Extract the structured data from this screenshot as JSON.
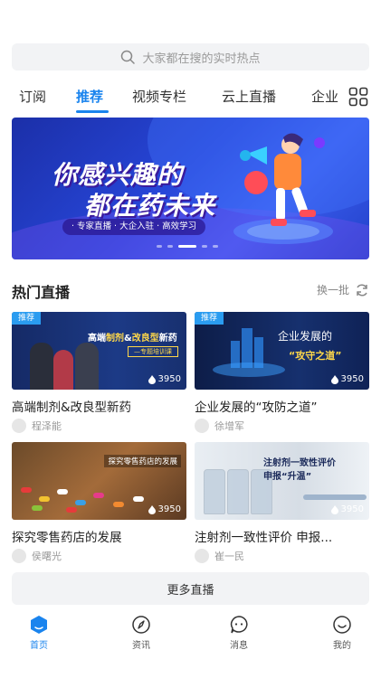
{
  "search": {
    "placeholder": "大家都在搜的实时热点"
  },
  "tabs": [
    {
      "label": "订阅",
      "active": false
    },
    {
      "label": "推荐",
      "active": true
    },
    {
      "label": "视频专栏",
      "active": false
    },
    {
      "label": "云上直播",
      "active": false
    },
    {
      "label": "企业",
      "active": false
    }
  ],
  "banner": {
    "line1": "你感兴趣的",
    "line2": "都在药未来",
    "tags": "· 专家直播 · 大企入驻 · 高效学习",
    "slides": 5,
    "active_slide": 3
  },
  "section": {
    "title": "热门直播",
    "refresh_label": "换一批"
  },
  "cards": [
    {
      "badge": "推荐",
      "thumb_title_a": "高端",
      "thumb_title_b": "制剂",
      "thumb_title_c": "&",
      "thumb_title_d": "改良型",
      "thumb_title_e": "新药",
      "thumb_sub": "—专题培训课",
      "views": "3950",
      "title": "高端制剂&改良型新药",
      "author": "程泽能"
    },
    {
      "badge": "推荐",
      "thumb_title_a": "企业发展的",
      "thumb_sub": "“攻守之道”",
      "views": "3950",
      "title": "企业发展的“攻防之道”",
      "author": "徐增军"
    },
    {
      "thumb_title_a": "探究零售药店的发展",
      "views": "3950",
      "title": "探究零售药店的发展",
      "author": "侯曙光"
    },
    {
      "thumb_title_a": "注射剂一致性评价",
      "thumb_sub": "申报“升温”",
      "views": "3950",
      "title": "注射剂一致性评价 申报...",
      "author": "崔一民"
    }
  ],
  "more_button": "更多直播",
  "nav": [
    {
      "label": "首页",
      "icon": "home-icon",
      "active": true
    },
    {
      "label": "资讯",
      "icon": "compass-icon",
      "active": false
    },
    {
      "label": "消息",
      "icon": "chat-icon",
      "active": false
    },
    {
      "label": "我的",
      "icon": "smile-icon",
      "active": false
    }
  ],
  "colors": {
    "accent": "#1a84ee",
    "badge": "#2a9cf0",
    "banner": "#2746d8"
  }
}
